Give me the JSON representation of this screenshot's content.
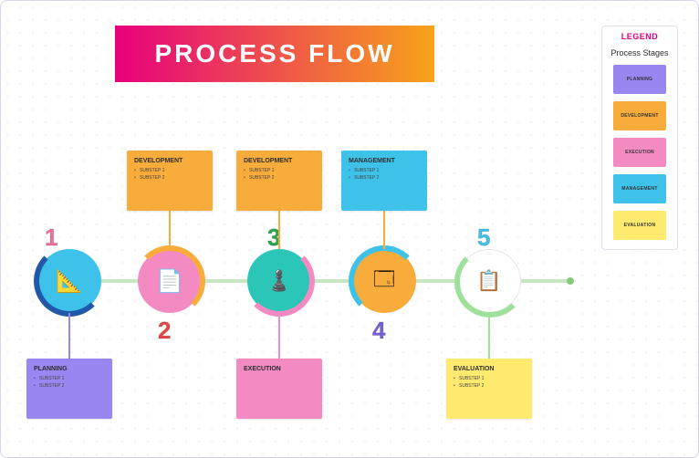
{
  "title": "PROCESS FLOW",
  "legend": {
    "title": "LEGEND",
    "subtitle": "Process Stages",
    "items": [
      {
        "label": "PLANNING",
        "color": "#9a86f0"
      },
      {
        "label": "DEVELOPMENT",
        "color": "#f8ac3b"
      },
      {
        "label": "EXECUTION",
        "color": "#f38ac2"
      },
      {
        "label": "MANAGEMENT",
        "color": "#3ec2e9"
      },
      {
        "label": "EVALUATION",
        "color": "#fdea6f"
      }
    ]
  },
  "nodes": [
    {
      "num": "1",
      "num_color": "#f06fa0",
      "circle_color": "#3ec2e9",
      "ring_color": "#2158a9",
      "num_pos": "top",
      "card": {
        "label": "PLANNING",
        "subs": [
          "SUBSTEP 1",
          "SUBSTEP 2"
        ],
        "color": "#9a86f0",
        "side": "bottom"
      }
    },
    {
      "num": "2",
      "num_color": "#e64848",
      "circle_color": "#f38ac2",
      "ring_color": "#f8ac3b",
      "num_pos": "bottom",
      "card": {
        "label": "DEVELOPMENT",
        "subs": [
          "SUBSTEP 1",
          "SUBSTEP 2"
        ],
        "color": "#f8ac3b",
        "side": "top"
      }
    },
    {
      "num": "3",
      "num_color": "#2aa84a",
      "circle_color": "#2bc6b8",
      "ring_color": "#f38ac2",
      "num_pos": "top",
      "card": {
        "label": "DEVELOPMENT",
        "subs": [
          "SUBSTEP 1",
          "SUBSTEP 2"
        ],
        "color": "#f8ac3b",
        "side": "top"
      },
      "card2": {
        "label": "EXECUTION",
        "subs": [],
        "color": "#f38ac2",
        "side": "bottom"
      }
    },
    {
      "num": "4",
      "num_color": "#7860d6",
      "circle_color": "#f8ac3b",
      "ring_color": "#3ec2e9",
      "num_pos": "bottom",
      "card": {
        "label": "MANAGEMENT",
        "subs": [
          "SUBSTEP 1",
          "SUBSTEP 2"
        ],
        "color": "#3ec2e9",
        "side": "top"
      }
    },
    {
      "num": "5",
      "num_color": "#3ec2e9",
      "circle_color": "#ffffff",
      "ring_color": "#9fe09a",
      "num_pos": "top",
      "card": {
        "label": "EVALUATION",
        "subs": [
          "SUBSTEP 1",
          "SUBSTEP 2"
        ],
        "color": "#fdea6f",
        "side": "bottom"
      }
    }
  ]
}
